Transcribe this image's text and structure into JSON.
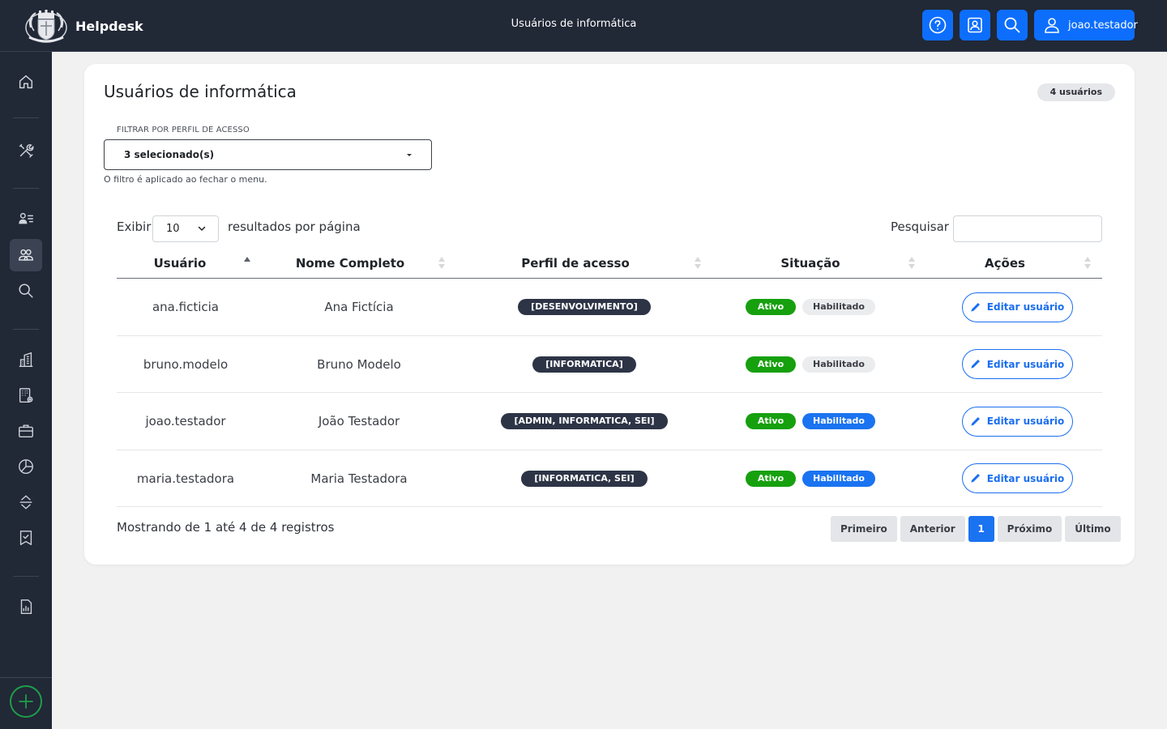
{
  "app": {
    "name": "Helpdesk"
  },
  "header": {
    "title": "Usuários de informática",
    "username": "joao.testador",
    "buttons": [
      "help-icon",
      "contact-card-icon",
      "search-icon"
    ]
  },
  "sidebar": {
    "items": [
      "home-icon",
      "tools-icon",
      "user-list-icon",
      "users-icon",
      "search-icon",
      "building-icon",
      "building-settings-icon",
      "briefcase-icon",
      "pie-chart-icon",
      "sort-arrows-icon",
      "checklist-icon",
      "report-icon"
    ],
    "active": "users-icon",
    "add_icon": "plus-circle-icon"
  },
  "page": {
    "title": "Usuários de informática",
    "count_badge": "4 usuários",
    "filter": {
      "label": "FILTRAR POR PERFIL DE ACESSO",
      "value": "3 selecionado(s)",
      "help": "O filtro é aplicado ao fechar o menu."
    },
    "length": {
      "prefix": "Exibir",
      "value": "10",
      "suffix": "resultados por página"
    },
    "search": {
      "label": "Pesquisar",
      "value": ""
    },
    "table": {
      "columns": [
        "Usuário",
        "Nome Completo",
        "Perfil de acesso",
        "Situação",
        "Ações"
      ],
      "sorted_column": "Usuário",
      "rows": [
        {
          "user": "ana.ficticia",
          "name": "Ana Fictícia",
          "role": "[DESENVOLVIMENTO]",
          "status": "Ativo",
          "enabled": "Habilitado",
          "enabled_highlight": false,
          "action": "Editar usuário"
        },
        {
          "user": "bruno.modelo",
          "name": "Bruno Modelo",
          "role": "[INFORMATICA]",
          "status": "Ativo",
          "enabled": "Habilitado",
          "enabled_highlight": false,
          "action": "Editar usuário"
        },
        {
          "user": "joao.testador",
          "name": "João Testador",
          "role": "[ADMIN, INFORMATICA, SEI]",
          "status": "Ativo",
          "enabled": "Habilitado",
          "enabled_highlight": true,
          "action": "Editar usuário"
        },
        {
          "user": "maria.testadora",
          "name": "Maria Testadora",
          "role": "[INFORMATICA, SEI]",
          "status": "Ativo",
          "enabled": "Habilitado",
          "enabled_highlight": true,
          "action": "Editar usuário"
        }
      ]
    },
    "info": "Mostrando de 1 até 4 de 4 registros",
    "pagination": {
      "first": "Primeiro",
      "prev": "Anterior",
      "current": "1",
      "next": "Próximo",
      "last": "Último"
    }
  },
  "colors": {
    "topbar": "#212836",
    "primary": "#0d6efd",
    "active_green": "#16a00e",
    "role_badge": "#2d3446",
    "enabled_blue": "#1a73f0"
  }
}
